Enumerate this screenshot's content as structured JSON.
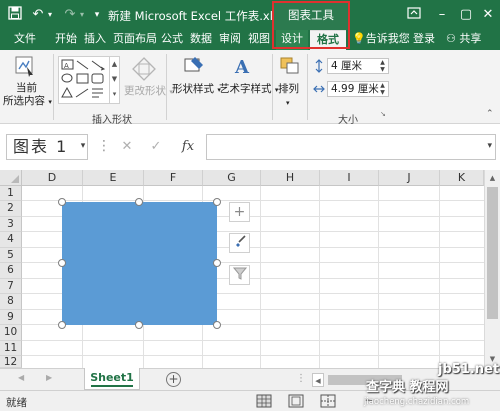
{
  "titlebar": {
    "doc_title": "新建 Microsoft Excel 工作表.xls...",
    "context_title": "图表工具",
    "bg_color": "#217346"
  },
  "tabs": [
    "文件",
    "开始",
    "插入",
    "页面布局",
    "公式",
    "数据",
    "审阅",
    "视图",
    "设计",
    "格式"
  ],
  "tellme": "告诉我您",
  "login": "登录",
  "share": "共享",
  "ribbon": {
    "current_selection": "当前",
    "current_selection_2": "所选内容",
    "insert_shapes_group": "插入形状",
    "change_shape": "更改形状",
    "shape_styles": "形状样式",
    "wordart_styles": "艺术字样式",
    "arrange": "排列",
    "size_group": "大小",
    "height_value": "4 厘米",
    "width_value": "4.99 厘米"
  },
  "formula_bar": {
    "name_box": "图表 1",
    "fx_label": "fx"
  },
  "columns": [
    "D",
    "E",
    "F",
    "G",
    "H",
    "I",
    "J",
    "K"
  ],
  "rows": [
    "1",
    "2",
    "3",
    "4",
    "5",
    "6",
    "7",
    "8",
    "9",
    "10",
    "11",
    "12"
  ],
  "chart": {
    "fill_color": "#5b9bd5"
  },
  "sheet_tab": "Sheet1",
  "status": "就绪",
  "watermark": {
    "site": "jb51.net",
    "top": "查字典 教程网",
    "bottom": "jiaocheng.chazidian.com"
  }
}
